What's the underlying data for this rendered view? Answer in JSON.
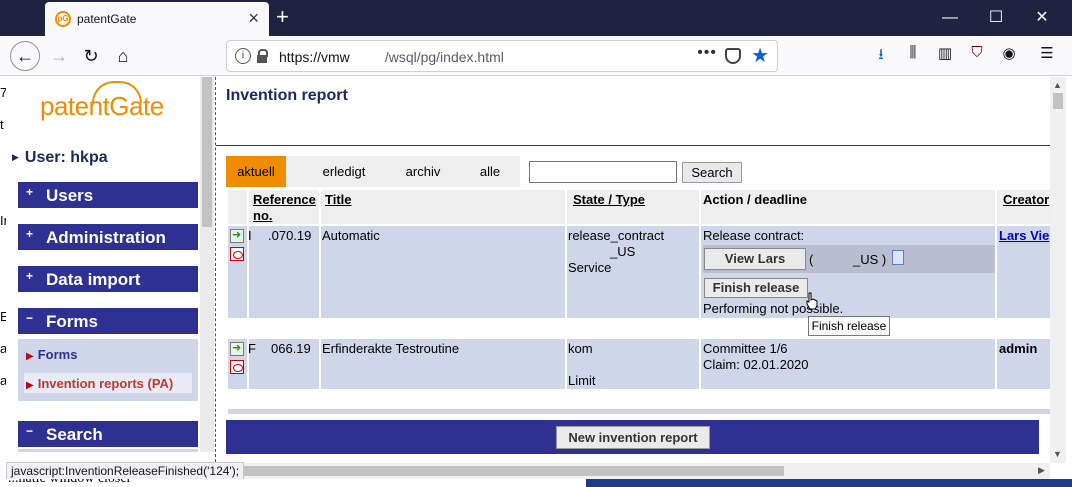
{
  "browser": {
    "tab_title": "patentGate",
    "favicon_text": "pG",
    "url_host": "https://vmw",
    "url_path": "/wsql/pg/index.html",
    "status_text": "javascript:InventionReleaseFinished('124');"
  },
  "sidebar": {
    "logo": "patentGate",
    "user_label": "User: hkpa",
    "menus": [
      {
        "label": "Users",
        "expander": "+"
      },
      {
        "label": "Administration",
        "expander": "+"
      },
      {
        "label": "Data import",
        "expander": "+"
      },
      {
        "label": "Forms",
        "expander": "−"
      },
      {
        "label": "Search",
        "expander": "−"
      }
    ],
    "forms_items": [
      "Forms",
      "Invention reports (PA)"
    ]
  },
  "main": {
    "title": "Invention report",
    "filter_tabs": [
      "aktuell",
      "erledigt",
      "archiv",
      "alle"
    ],
    "search_value": "",
    "search_button": "Search",
    "columns": [
      "Reference no.",
      "Title",
      "State / Type",
      "Action / deadline",
      "Creator"
    ],
    "rows": [
      {
        "ref_prefix": "I",
        "ref": ".070.19",
        "title": "Automatic",
        "state": "release_contract",
        "state2": "_US",
        "type": "Service",
        "action_label": "Release contract:",
        "view_button": "View Lars",
        "view_suffix": "(",
        "view_suffix2": "_US )",
        "finish_button": "Finish release",
        "note": "Performing not possible.",
        "creator": "Lars Vie"
      },
      {
        "ref_prefix": "F",
        "ref": "066.19",
        "title": "Erfinderakte Testroutine",
        "state": "kom",
        "type": "Limit",
        "action_label": "Committee 1/6",
        "claim": "Claim: 02.01.2020",
        "creator": "admin"
      }
    ],
    "tooltip": "Finish release",
    "new_report_button": "New invention report"
  },
  "background_fragment": "...natic window closer"
}
